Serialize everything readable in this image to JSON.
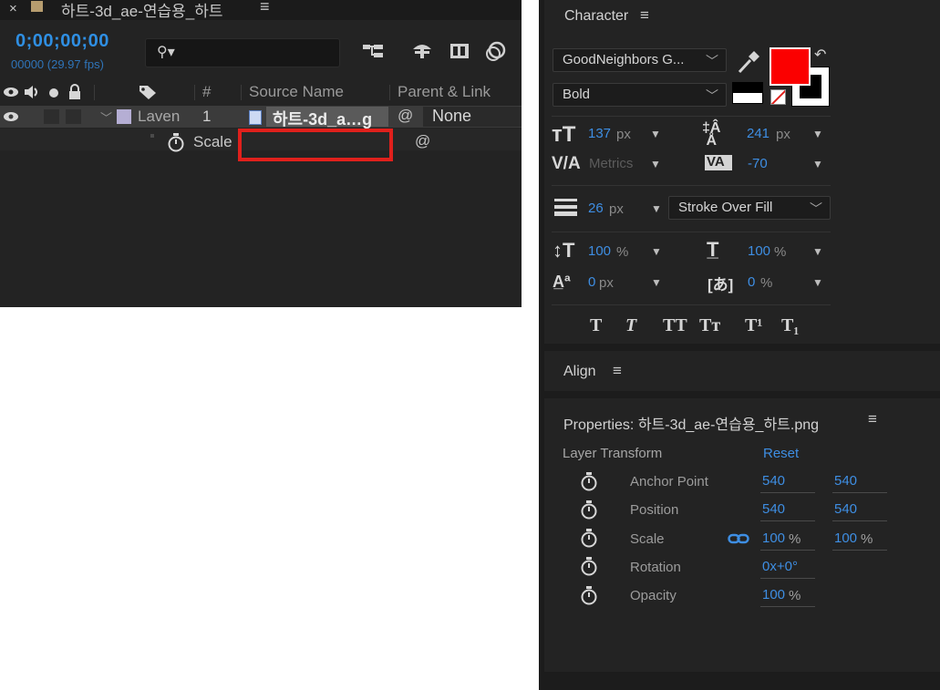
{
  "timeline": {
    "tab": {
      "close": "×",
      "title": "하트-3d_ae-연습용_하트",
      "menu": "≡"
    },
    "timecode": "0;00;00;00",
    "frames": "00000 (29.97 fps)",
    "search_glyph": "⚲▾",
    "columns": {
      "source_name": "Source Name",
      "parent_link": "Parent & Link",
      "number": "#"
    },
    "layer": {
      "name": "Laven",
      "number": "1",
      "source": "하트-3d_a…g",
      "parent": "None",
      "label_color": "#b5aed4"
    },
    "property": {
      "name": "Scale"
    },
    "highlight_color": "#e0201c"
  },
  "character": {
    "title": "Character",
    "menu": "≡",
    "font_family": "GoodNeighbors G...",
    "font_style": "Bold",
    "fill_color": "#fb0000",
    "stroke_color": "#ffffff",
    "font_size": {
      "value": "137",
      "unit": "px"
    },
    "leading": {
      "value": "241",
      "unit": "px"
    },
    "kerning": {
      "value": "Metrics"
    },
    "tracking": {
      "value": "-70"
    },
    "stroke_width": {
      "value": "26",
      "unit": "px"
    },
    "stroke_mode": "Stroke Over Fill",
    "vertical_scale": {
      "value": "100",
      "unit": "%"
    },
    "horizontal_scale": {
      "value": "100",
      "unit": "%"
    },
    "baseline_shift": {
      "value": "0",
      "unit": "px"
    },
    "tsume": {
      "value": "0",
      "unit": "%"
    },
    "format_buttons": [
      "T",
      "T",
      "TT",
      "Tт",
      "T¹",
      "T₁"
    ]
  },
  "align": {
    "title": "Align",
    "menu": "≡"
  },
  "properties": {
    "title": "Properties: 하트-3d_ae-연습용_하트.png",
    "menu": "≡",
    "section": "Layer Transform",
    "reset": "Reset",
    "rows": [
      {
        "label": "Anchor Point",
        "x": "540",
        "y": "540"
      },
      {
        "label": "Position",
        "x": "540",
        "y": "540"
      },
      {
        "label": "Scale",
        "x": "100",
        "y": "100",
        "unit": "%"
      },
      {
        "label": "Rotation",
        "x": "0x+0°"
      },
      {
        "label": "Opacity",
        "x": "100",
        "unit": "%"
      }
    ]
  }
}
